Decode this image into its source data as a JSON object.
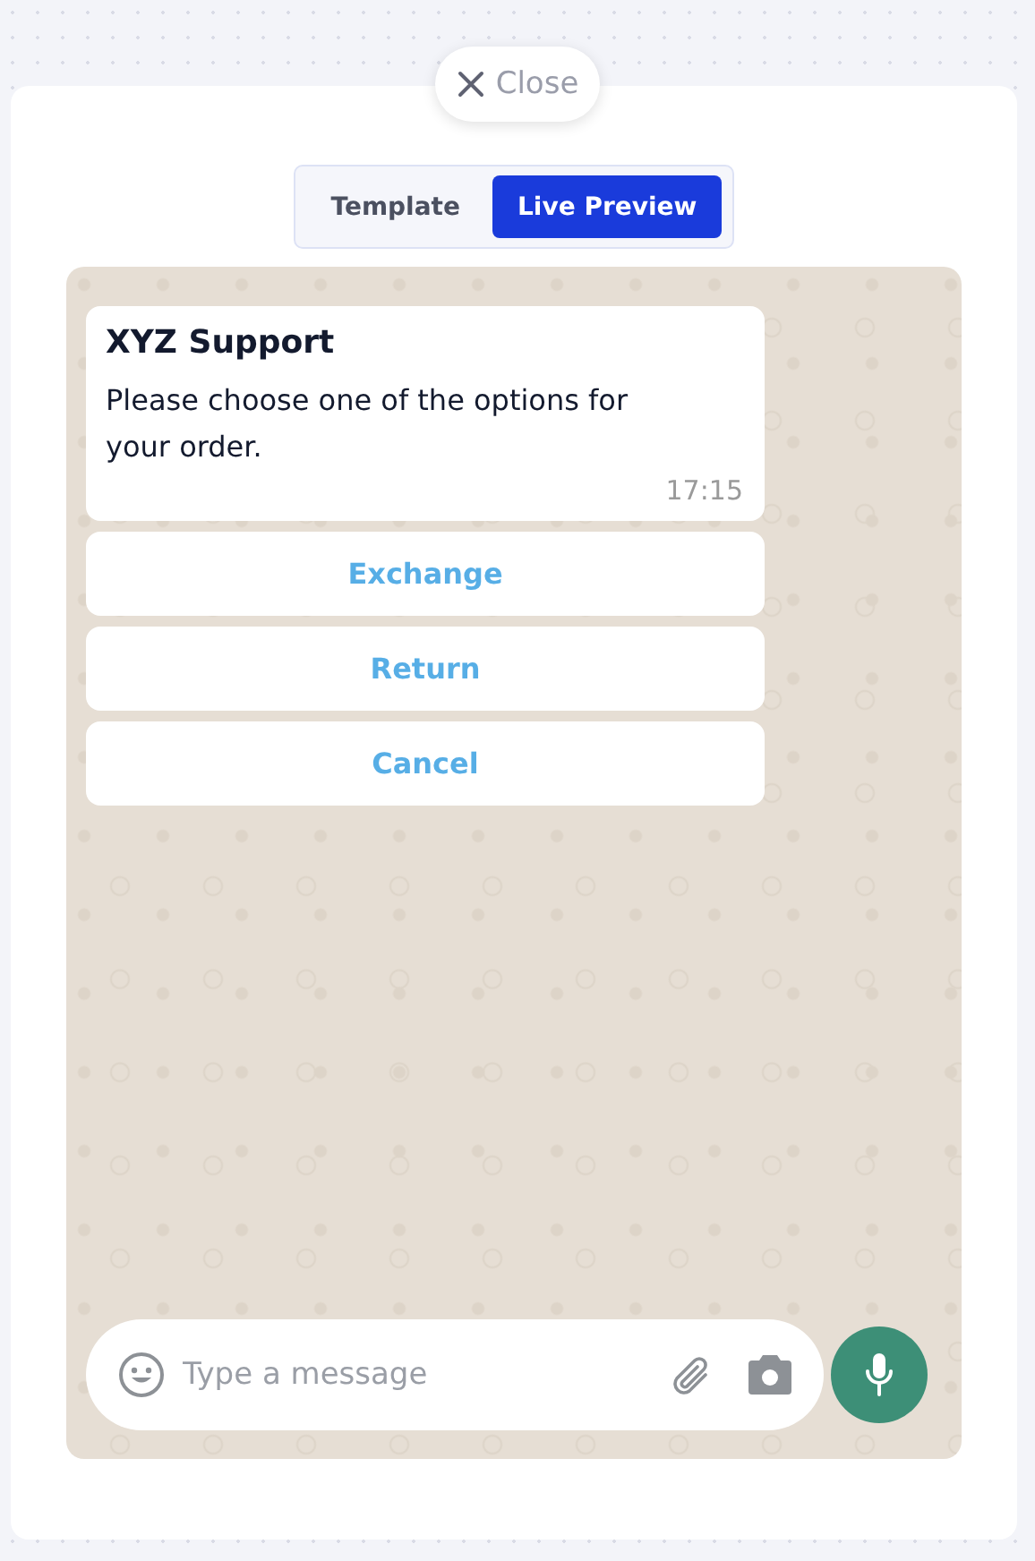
{
  "close_button": {
    "label": "Close"
  },
  "tabs": [
    {
      "label": "Template",
      "selected": false
    },
    {
      "label": "Live Preview",
      "selected": true
    }
  ],
  "message": {
    "title": "XYZ Support",
    "body": "Please choose one of the options for your order.",
    "time": "17:15"
  },
  "quick_replies": [
    "Exchange",
    "Return",
    "Cancel"
  ],
  "composer": {
    "placeholder": "Type a message"
  }
}
